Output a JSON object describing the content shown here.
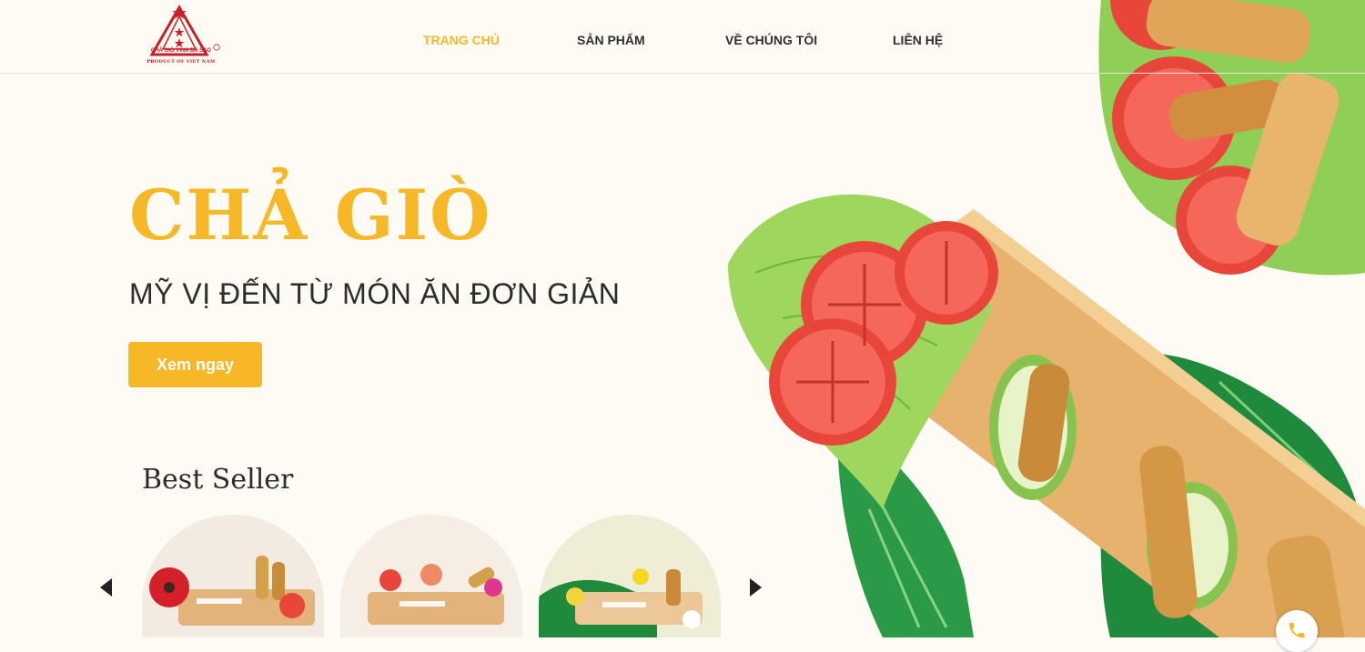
{
  "brand": {
    "logo_text": "CHẢ GIÒ VINA BA SAO",
    "logo_caption": "PRODUCT OF VIET NAM",
    "registered_mark": "®"
  },
  "nav": {
    "items": [
      {
        "label": "TRANG CHỦ",
        "active": true
      },
      {
        "label": "SẢN PHẨM",
        "active": false
      },
      {
        "label": "VỀ CHÚNG TÔI",
        "active": false
      },
      {
        "label": "LIÊN HỆ",
        "active": false
      }
    ]
  },
  "hero": {
    "title": "CHẢ GIÒ",
    "subtitle": "MỸ VỊ ĐẾN TỪ MÓN ĂN ĐƠN GIẢN",
    "cta_label": "Xem ngay"
  },
  "best_seller": {
    "title": "Best Seller",
    "arrows": {
      "prev_icon": "caret-left-icon",
      "next_icon": "caret-right-icon"
    }
  },
  "floating": {
    "phone_icon": "phone-icon"
  },
  "colors": {
    "accent": "#f6b827",
    "text_dark": "#2c2c2c",
    "background": "#fdfbf4",
    "logo_red": "#c8202a"
  }
}
